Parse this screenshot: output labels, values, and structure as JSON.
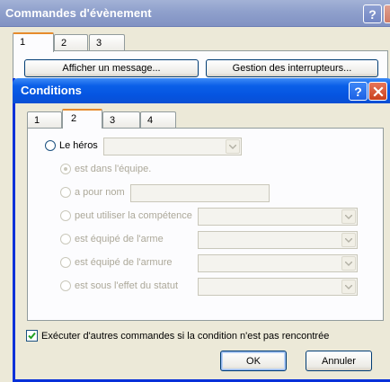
{
  "bg_window": {
    "title": "Commandes d'évènement",
    "tabs": [
      "1",
      "2",
      "3"
    ],
    "buttons": [
      "Afficher un message...",
      "Gestion des interrupteurs..."
    ]
  },
  "dialog": {
    "title": "Conditions",
    "tabs": [
      "1",
      "2",
      "3",
      "4"
    ],
    "active_tab": "2",
    "hero": {
      "label": "Le héros",
      "selected": false,
      "combo_value": ""
    },
    "sub_options": [
      {
        "label": "est dans l'équipe.",
        "checked": true,
        "disabled": true
      },
      {
        "label": "a pour nom",
        "checked": false,
        "disabled": true,
        "text_value": ""
      },
      {
        "label": "peut utiliser la compétence",
        "checked": false,
        "disabled": true,
        "combo_value": ""
      },
      {
        "label": "est équipé de l'arme",
        "checked": false,
        "disabled": true,
        "combo_value": ""
      },
      {
        "label": "est équipé de l'armure",
        "checked": false,
        "disabled": true,
        "combo_value": ""
      },
      {
        "label": "est sous l'effet du statut",
        "checked": false,
        "disabled": true,
        "combo_value": ""
      }
    ],
    "else_checkbox": {
      "label": "Exécuter d'autres commandes si la condition n'est pas rencontrée",
      "checked": true
    },
    "ok_label": "OK",
    "cancel_label": "Annuler"
  },
  "icons": {
    "help": "help-icon",
    "close": "close-icon",
    "dropdown": "chevron-down-icon",
    "check": "check-icon"
  },
  "colors": {
    "titlebar_active": "#0554e0",
    "titlebar_inactive": "#8fa0cc",
    "tab_highlight": "#e68b2c",
    "disabled_text": "#aca899"
  }
}
